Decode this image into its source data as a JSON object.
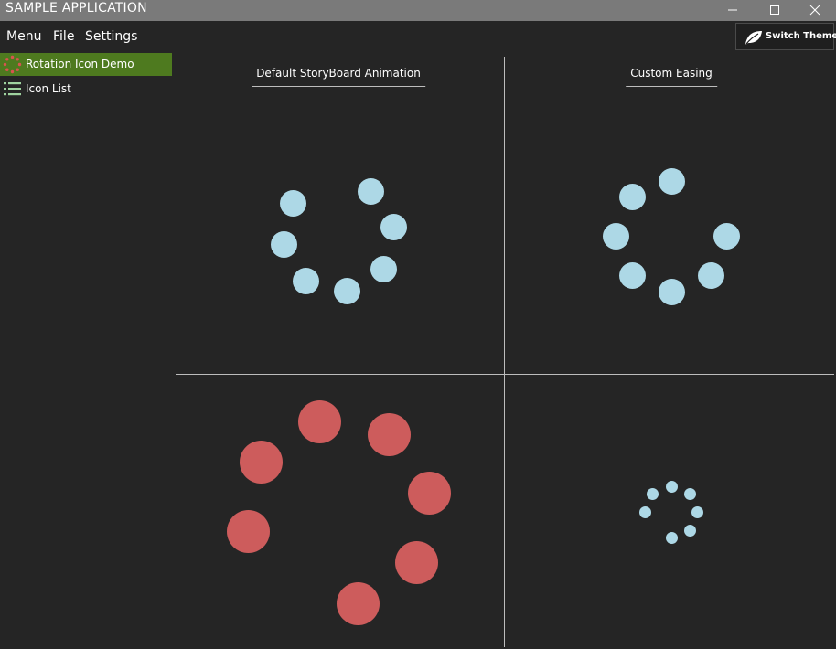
{
  "window": {
    "title": "SAMPLE APPLICATION",
    "controls": [
      "minimize-icon",
      "maximize-icon",
      "close-icon"
    ]
  },
  "menu": {
    "items": [
      {
        "label": "Menu"
      },
      {
        "label": "File"
      },
      {
        "label": "Settings"
      }
    ]
  },
  "theme_button": {
    "label": "Switch Theme",
    "icon": "leaf-icon"
  },
  "sidebar": {
    "items": [
      {
        "label": "Rotation Icon Demo",
        "icon": "rotation-dots-icon",
        "selected": true
      },
      {
        "label": "Icon List",
        "icon": "list-icon",
        "selected": false
      }
    ]
  },
  "panels": {
    "top_left": {
      "title": "Default StoryBoard Animation"
    },
    "top_right": {
      "title": "Custom Easing"
    }
  },
  "colors": {
    "titlebar_bg": "#7a7a7a",
    "window_bg": "#252525",
    "selected_nav_bg": "#4e7a1f",
    "spinner_blue": "#add8e6",
    "spinner_red": "#cd5c5c",
    "divider": "#bdbdbd"
  }
}
